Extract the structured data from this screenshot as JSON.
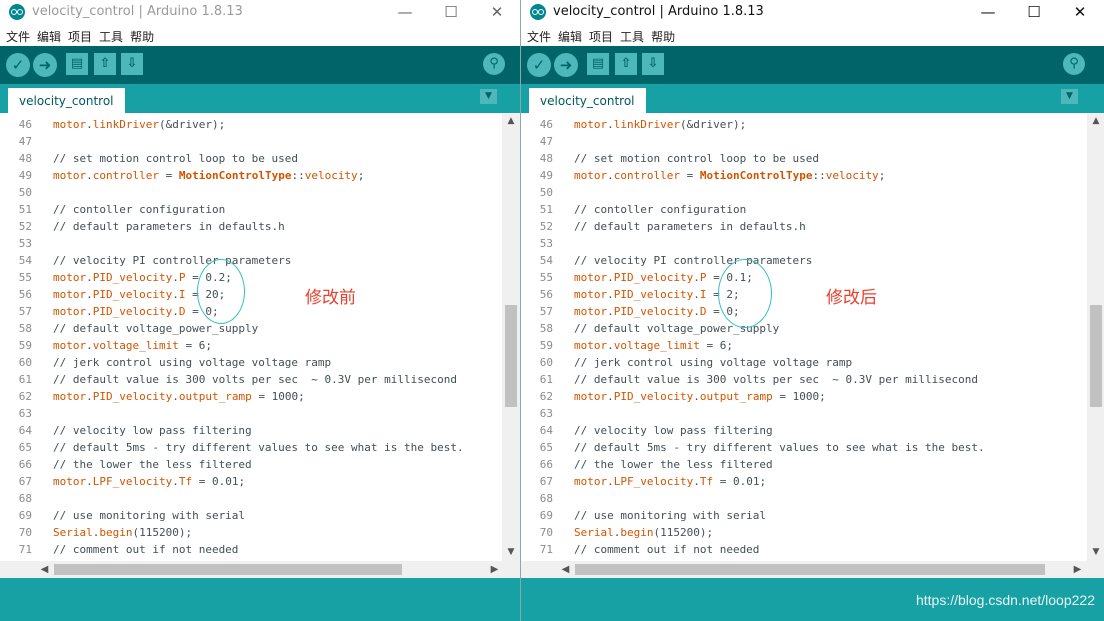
{
  "windows": [
    {
      "title": "velocity_control | Arduino 1.8.13",
      "menu": [
        "文件",
        "编辑",
        "项目",
        "工具",
        "帮助"
      ],
      "tab_label": "velocity_control",
      "annotation": "修改前",
      "lines": [
        {
          "n": "46",
          "code": "motor.linkDriver(&driver);"
        },
        {
          "n": "47",
          "code": ""
        },
        {
          "n": "48",
          "code": "// set motion control loop to be used"
        },
        {
          "n": "49",
          "code": "motor.controller = MotionControlType::velocity;"
        },
        {
          "n": "50",
          "code": ""
        },
        {
          "n": "51",
          "code": "// contoller configuration"
        },
        {
          "n": "52",
          "code": "// default parameters in defaults.h"
        },
        {
          "n": "53",
          "code": ""
        },
        {
          "n": "54",
          "code": "// velocity PI controller parameters"
        },
        {
          "n": "55",
          "code": "motor.PID_velocity.P = 0.2;"
        },
        {
          "n": "56",
          "code": "motor.PID_velocity.I = 20;"
        },
        {
          "n": "57",
          "code": "motor.PID_velocity.D = 0;"
        },
        {
          "n": "58",
          "code": "// default voltage_power_supply"
        },
        {
          "n": "59",
          "code": "motor.voltage_limit = 6;"
        },
        {
          "n": "60",
          "code": "// jerk control using voltage voltage ramp"
        },
        {
          "n": "61",
          "code": "// default value is 300 volts per sec  ~ 0.3V per millisecond"
        },
        {
          "n": "62",
          "code": "motor.PID_velocity.output_ramp = 1000;"
        },
        {
          "n": "63",
          "code": ""
        },
        {
          "n": "64",
          "code": "// velocity low pass filtering"
        },
        {
          "n": "65",
          "code": "// default 5ms - try different values to see what is the best."
        },
        {
          "n": "66",
          "code": "// the lower the less filtered"
        },
        {
          "n": "67",
          "code": "motor.LPF_velocity.Tf = 0.01;"
        },
        {
          "n": "68",
          "code": ""
        },
        {
          "n": "69",
          "code": "// use monitoring with serial"
        },
        {
          "n": "70",
          "code": "Serial.begin(115200);"
        },
        {
          "n": "71",
          "code": "// comment out if not needed"
        }
      ]
    },
    {
      "title": "velocity_control | Arduino 1.8.13",
      "menu": [
        "文件",
        "编辑",
        "项目",
        "工具",
        "帮助"
      ],
      "tab_label": "velocity_control",
      "annotation": "修改后",
      "lines": [
        {
          "n": "46",
          "code": "motor.linkDriver(&driver);"
        },
        {
          "n": "47",
          "code": ""
        },
        {
          "n": "48",
          "code": "// set motion control loop to be used"
        },
        {
          "n": "49",
          "code": "motor.controller = MotionControlType::velocity;"
        },
        {
          "n": "50",
          "code": ""
        },
        {
          "n": "51",
          "code": "// contoller configuration"
        },
        {
          "n": "52",
          "code": "// default parameters in defaults.h"
        },
        {
          "n": "53",
          "code": ""
        },
        {
          "n": "54",
          "code": "// velocity PI controller parameters"
        },
        {
          "n": "55",
          "code": "motor.PID_velocity.P = 0.1;"
        },
        {
          "n": "56",
          "code": "motor.PID_velocity.I = 2;"
        },
        {
          "n": "57",
          "code": "motor.PID_velocity.D = 0;"
        },
        {
          "n": "58",
          "code": "// default voltage_power_supply"
        },
        {
          "n": "59",
          "code": "motor.voltage_limit = 6;"
        },
        {
          "n": "60",
          "code": "// jerk control using voltage voltage ramp"
        },
        {
          "n": "61",
          "code": "// default value is 300 volts per sec  ~ 0.3V per millisecond"
        },
        {
          "n": "62",
          "code": "motor.PID_velocity.output_ramp = 1000;"
        },
        {
          "n": "63",
          "code": ""
        },
        {
          "n": "64",
          "code": "// velocity low pass filtering"
        },
        {
          "n": "65",
          "code": "// default 5ms - try different values to see what is the best."
        },
        {
          "n": "66",
          "code": "// the lower the less filtered"
        },
        {
          "n": "67",
          "code": "motor.LPF_velocity.Tf = 0.01;"
        },
        {
          "n": "68",
          "code": ""
        },
        {
          "n": "69",
          "code": "// use monitoring with serial"
        },
        {
          "n": "70",
          "code": "Serial.begin(115200);"
        },
        {
          "n": "71",
          "code": "// comment out if not needed"
        }
      ]
    }
  ],
  "watermark": "https://blog.csdn.net/loop222",
  "icons": {
    "verify": "checkmark-icon",
    "upload": "arrow-right-icon",
    "new": "new-file-icon",
    "open": "open-arrow-up-icon",
    "save": "save-arrow-down-icon",
    "serial_monitor": "magnifier-icon",
    "tab_menu": "chevron-down-icon"
  },
  "colors": {
    "toolbar": "#006468",
    "tabbar": "#17a1a5",
    "keyword": "#d35400",
    "annotation": "#ea3f2e",
    "ellipse": "#33c0c7"
  }
}
